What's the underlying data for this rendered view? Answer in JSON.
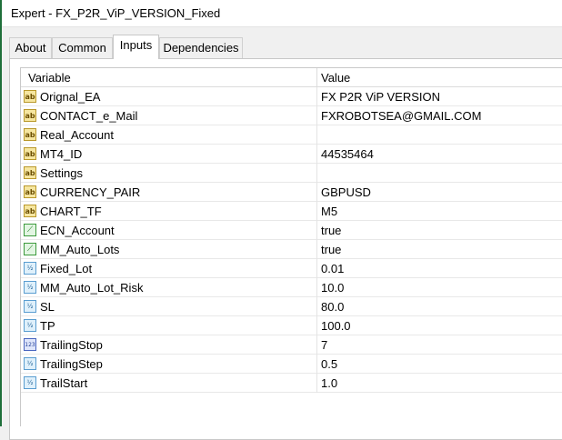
{
  "window": {
    "title": "Expert - FX_P2R_ViP_VERSION_Fixed"
  },
  "tabs": [
    "About",
    "Common",
    "Inputs",
    "Dependencies"
  ],
  "grid": {
    "headers": {
      "variable": "Variable",
      "value": "Value"
    },
    "rows": [
      {
        "icon": "ab",
        "icon_name": "string-type-icon",
        "icon_text": "ab",
        "name": "Orignal_EA",
        "value": "FX P2R ViP VERSION"
      },
      {
        "icon": "ab",
        "icon_name": "string-type-icon",
        "icon_text": "ab",
        "name": "CONTACT_e_Mail",
        "value": "FXROBOTSEA@GMAIL.COM"
      },
      {
        "icon": "ab",
        "icon_name": "string-type-icon",
        "icon_text": "ab",
        "name": "Real_Account",
        "value": ""
      },
      {
        "icon": "ab",
        "icon_name": "string-type-icon",
        "icon_text": "ab",
        "name": "MT4_ID",
        "value": "44535464"
      },
      {
        "icon": "ab",
        "icon_name": "string-type-icon",
        "icon_text": "ab",
        "name": "Settings",
        "value": ""
      },
      {
        "icon": "ab",
        "icon_name": "string-type-icon",
        "icon_text": "ab",
        "name": "CURRENCY_PAIR",
        "value": "GBPUSD"
      },
      {
        "icon": "ab",
        "icon_name": "string-type-icon",
        "icon_text": "ab",
        "name": "CHART_TF",
        "value": "M5"
      },
      {
        "icon": "bool",
        "icon_name": "boolean-type-icon",
        "icon_text": "⟋",
        "name": "ECN_Account",
        "value": "true"
      },
      {
        "icon": "bool",
        "icon_name": "boolean-type-icon",
        "icon_text": "⟋",
        "name": "MM_Auto_Lots",
        "value": "true"
      },
      {
        "icon": "dbl",
        "icon_name": "double-type-icon",
        "icon_text": "½",
        "name": "Fixed_Lot",
        "value": "0.01"
      },
      {
        "icon": "dbl",
        "icon_name": "double-type-icon",
        "icon_text": "½",
        "name": "MM_Auto_Lot_Risk",
        "value": "10.0"
      },
      {
        "icon": "dbl",
        "icon_name": "double-type-icon",
        "icon_text": "½",
        "name": "SL",
        "value": "80.0"
      },
      {
        "icon": "dbl",
        "icon_name": "double-type-icon",
        "icon_text": "½",
        "name": "TP",
        "value": "100.0"
      },
      {
        "icon": "int",
        "icon_name": "integer-type-icon",
        "icon_text": "123",
        "name": "TrailingStop",
        "value": "7"
      },
      {
        "icon": "dbl",
        "icon_name": "double-type-icon",
        "icon_text": "½",
        "name": "TrailingStep",
        "value": "0.5"
      },
      {
        "icon": "dbl",
        "icon_name": "double-type-icon",
        "icon_text": "½",
        "name": "TrailStart",
        "value": "1.0"
      }
    ]
  }
}
